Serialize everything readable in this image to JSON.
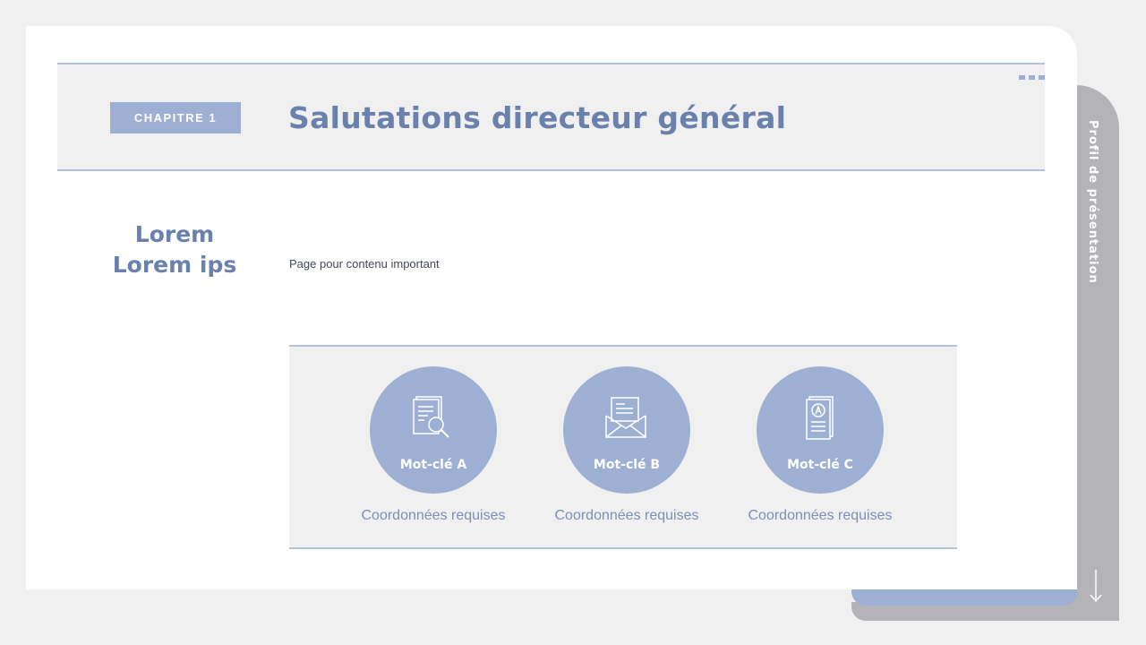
{
  "side_tab": {
    "label": "Profil de présentation"
  },
  "header": {
    "chapter": "CHAPITRE 1",
    "title": "Salutations directeur général"
  },
  "subtitle": {
    "line1": "Lorem",
    "line2": "Lorem ips"
  },
  "intro": "Page pour contenu important",
  "items": [
    {
      "icon": "document-search-icon",
      "label": "Mot-clé A",
      "caption": "Coordonnées requises"
    },
    {
      "icon": "envelope-letter-icon",
      "label": "Mot-clé B",
      "caption": "Coordonnées requises"
    },
    {
      "icon": "grade-document-icon",
      "label": "Mot-clé C",
      "caption": "Coordonnées requises"
    }
  ],
  "colors": {
    "accent": "#9db0d3",
    "title": "#6a80ad",
    "background": "#f0f0f1",
    "side_tab": "#b4b4b8"
  }
}
